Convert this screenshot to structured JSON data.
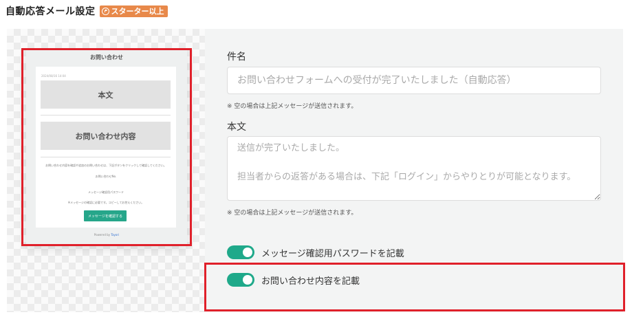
{
  "header": {
    "title": "自動応答メール設定",
    "plan_badge": "スターター以上",
    "plan_badge_icon": "arrow-up-circle-icon"
  },
  "preview": {
    "mail_title": "お問い合わせ",
    "date": "2024/08/16 14:04",
    "body_block": "本文",
    "inquiry_block": "お問い合わせ内容",
    "notice_text": "お問い合わせ内容を確認や追加のお問い合わせは、下記ボタンをクリックして確認してください。",
    "inquiry_no_label": "お問い合わせNo.",
    "password_label": "メッセージ確認用パスワード",
    "password_note": "※メッセージの確認に必要です。コピーしてお控えください。",
    "button_label": "メッセージを確認する",
    "powered_by_prefix": "Powered by",
    "powered_by_brand": "Tayori"
  },
  "form": {
    "subject_label": "件名",
    "subject_value": "",
    "subject_placeholder": "お問い合わせフォームへの受付が完了いたしました（自動応答）",
    "subject_hint": "※ 空の場合は上記メッセージが送信されます。",
    "body_label": "本文",
    "body_value": "",
    "body_placeholder": "送信が完了いたしました。\n\n担当者からの返答がある場合は、下記「ログイン」からやりとりが可能となります。",
    "body_hint": "※ 空の場合は上記メッセージが送信されます。"
  },
  "toggles": [
    {
      "label": "メッセージ確認用パスワードを記載",
      "state": "on"
    },
    {
      "label": "お問い合わせ内容を記載",
      "state": "on"
    }
  ],
  "colors": {
    "accent": "#1fa98a",
    "badge": "#e8894a",
    "highlight": "#e0202a"
  }
}
